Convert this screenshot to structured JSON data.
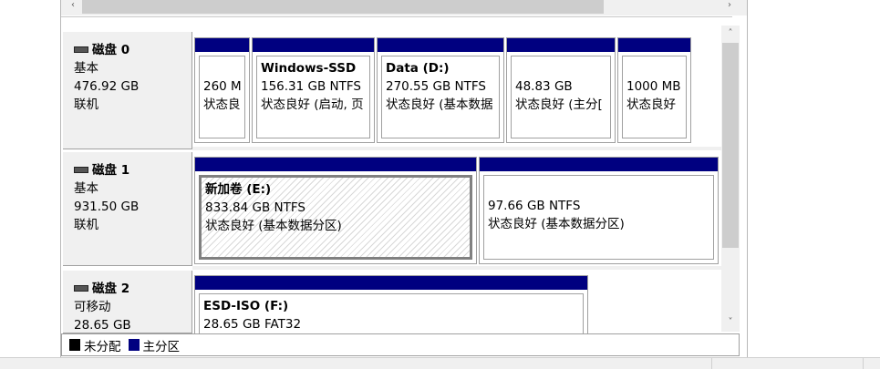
{
  "scroll": {
    "left_arrow": "‹",
    "right_arrow": "›",
    "up_arrow": "˄",
    "down_arrow": "˅"
  },
  "disks": [
    {
      "name": "磁盘 0",
      "type": "基本",
      "size": "476.92 GB",
      "status": "联机",
      "partitions": [
        {
          "name": "",
          "size": "260 M",
          "status": "状态良"
        },
        {
          "name": "Windows-SSD",
          "size": "156.31 GB NTFS",
          "status": "状态良好 (启动, 页"
        },
        {
          "name": "Data  (D:)",
          "size": "270.55 GB NTFS",
          "status": "状态良好 (基本数据"
        },
        {
          "name": "",
          "size": "48.83 GB",
          "status": "状态良好 (主分["
        },
        {
          "name": "",
          "size": "1000 MB",
          "status": "状态良好"
        }
      ]
    },
    {
      "name": "磁盘 1",
      "type": "基本",
      "size": "931.50 GB",
      "status": "联机",
      "partitions": [
        {
          "name": "新加卷  (E:)",
          "size": "833.84 GB NTFS",
          "status": "状态良好 (基本数据分区)"
        },
        {
          "name": "",
          "size": "97.66 GB NTFS",
          "status": "状态良好 (基本数据分区)"
        }
      ]
    },
    {
      "name": "磁盘 2",
      "type": "可移动",
      "size": "28.65 GB",
      "status": "",
      "partitions": [
        {
          "name": "ESD-ISO  (F:)",
          "size": "28.65 GB FAT32",
          "status": ""
        }
      ]
    }
  ],
  "legend": {
    "unallocated": "未分配",
    "primary": "主分区"
  },
  "colors": {
    "primary": "#000080",
    "unallocated": "#000000"
  }
}
